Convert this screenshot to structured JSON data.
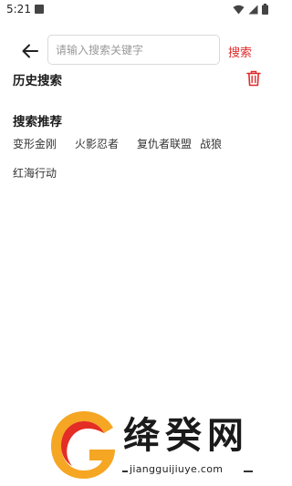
{
  "status_bar": {
    "time": "5:21"
  },
  "search": {
    "placeholder": "请输入搜索关键字",
    "value": "",
    "button_label": "搜索"
  },
  "history": {
    "title": "历史搜索"
  },
  "recommend": {
    "title": "搜索推荐",
    "tags": [
      "变形金刚",
      "火影忍者",
      "复仇者联盟",
      "战狼",
      "红海行动"
    ]
  },
  "watermark": {
    "brand": "绛癸网",
    "url": "jiangguijiuye.com",
    "colors": {
      "orange": "#f5a623",
      "red": "#e42d24"
    }
  },
  "colors": {
    "accent": "#e02b2b"
  }
}
